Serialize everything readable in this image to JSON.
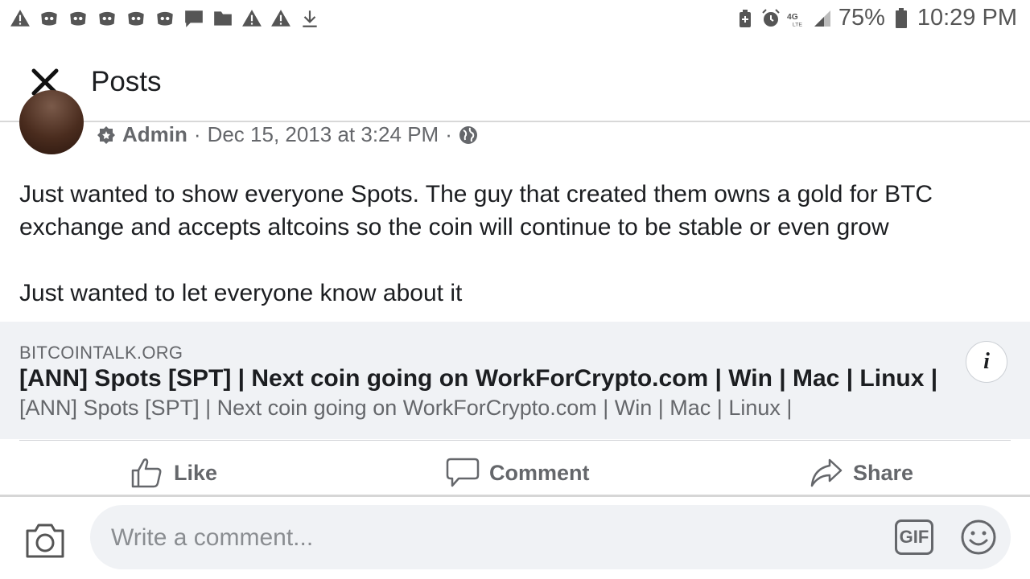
{
  "status_bar": {
    "battery": "75%",
    "time": "10:29 PM",
    "network": "4G LTE",
    "left_icons": [
      "warning-icon",
      "discord-icon",
      "discord-icon",
      "discord-icon",
      "discord-icon",
      "discord-icon",
      "message-icon",
      "folder-icon",
      "warning-icon",
      "warning-icon",
      "download-icon"
    ],
    "right_icons": [
      "battery-saver-icon",
      "alarm-icon",
      "lte-icon",
      "signal-icon",
      "battery-icon"
    ]
  },
  "header": {
    "title": "Posts"
  },
  "post": {
    "author_role": "Admin",
    "separator": "·",
    "timestamp": "Dec 15, 2013 at 3:24 PM",
    "privacy_icon": "globe-icon",
    "text_lines": [
      "Just wanted to show everyone Spots. The guy that created them owns a gold for BTC exchange and accepts altcoins so the coin will continue to be stable or even grow",
      "Just wanted to let everyone know about it"
    ]
  },
  "link_preview": {
    "domain": "BITCOINTALK.ORG",
    "title": "[ANN] Spots [SPT] | Next coin going on WorkForCrypto.com | Win | Mac | Linux |",
    "description": "[ANN] Spots [SPT] | Next coin going on WorkForCrypto.com | Win | Mac | Linux |",
    "info_label": "i"
  },
  "actions": {
    "like": "Like",
    "comment": "Comment",
    "share": "Share"
  },
  "composer": {
    "placeholder": "Write a comment...",
    "gif_label": "GIF"
  },
  "colors": {
    "text": "#1c1e21",
    "secondary": "#65676b",
    "preview_bg": "#f0f2f5"
  }
}
